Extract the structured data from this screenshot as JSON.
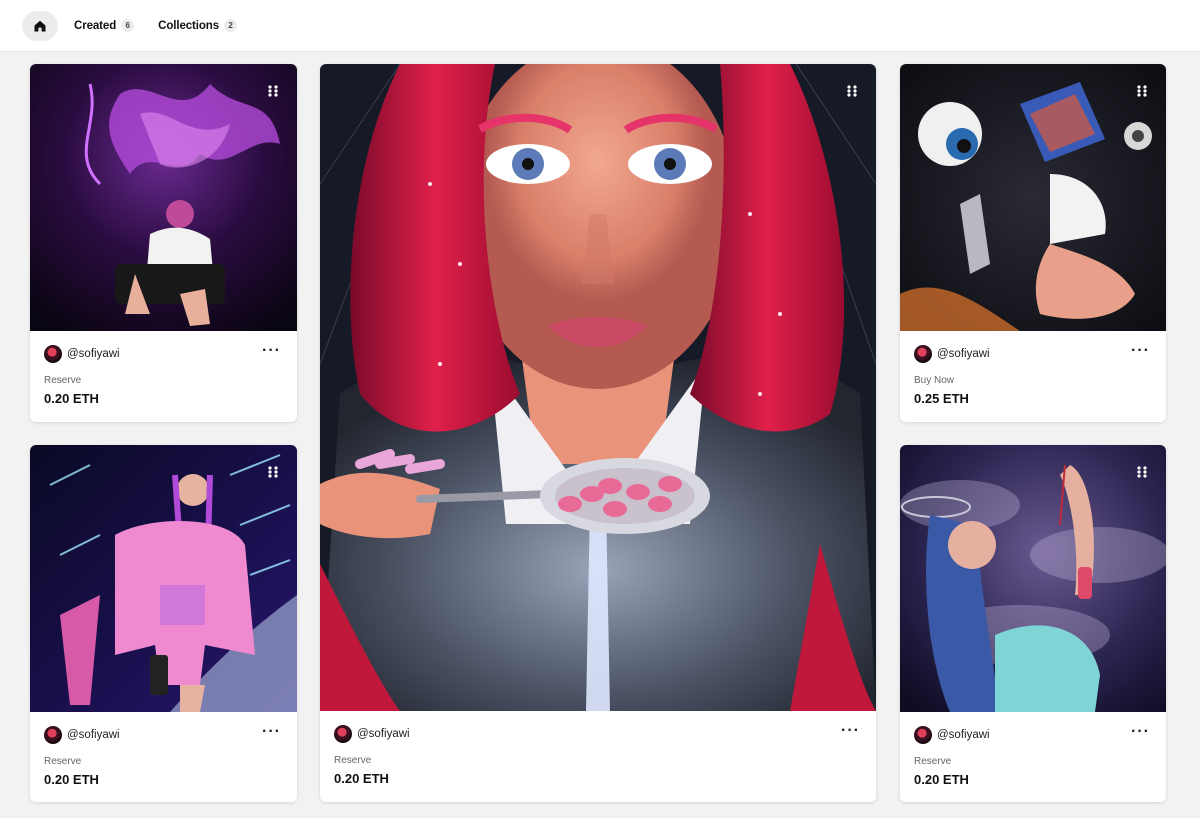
{
  "nav": {
    "home_icon": "home-icon",
    "tabs": [
      {
        "label": "Created",
        "count": "6"
      },
      {
        "label": "Collections",
        "count": "2"
      }
    ]
  },
  "cards": [
    {
      "creator": "@sofiyawi",
      "price_label": "Reserve",
      "price": "0.20 ETH"
    },
    {
      "creator": "@sofiyawi",
      "price_label": "Reserve",
      "price": "0.20 ETH"
    },
    {
      "creator": "@sofiyawi",
      "price_label": "Buy Now",
      "price": "0.25 ETH"
    },
    {
      "creator": "@sofiyawi",
      "price_label": "Reserve",
      "price": "0.20 ETH"
    },
    {
      "creator": "@sofiyawi",
      "price_label": "Reserve",
      "price": "0.20 ETH"
    }
  ],
  "more_icon": "more-dots-icon",
  "grip_icon": "grip-dots-icon"
}
